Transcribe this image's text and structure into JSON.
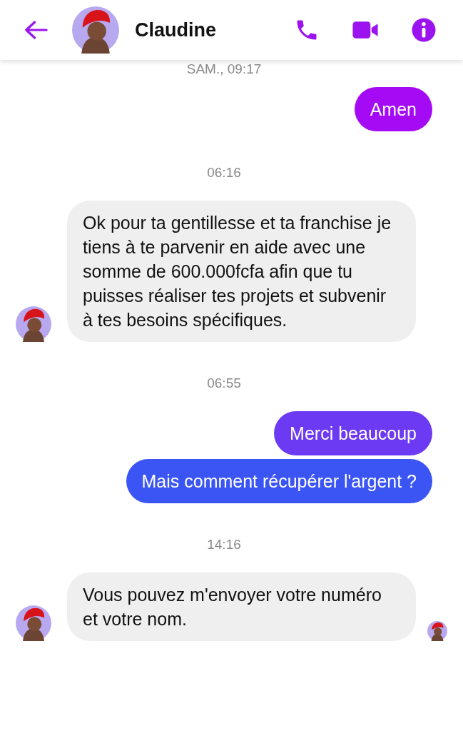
{
  "header": {
    "contact_name": "Claudine"
  },
  "messages": [
    {
      "kind": "timestamp",
      "text": "SAM., 09:17"
    },
    {
      "kind": "sent",
      "text": "Amen",
      "color": "#a50af5"
    },
    {
      "kind": "timestamp",
      "text": "06:16"
    },
    {
      "kind": "received",
      "text": "Ok pour ta gentillesse et ta franchise je tiens à te parvenir en aide avec une somme de 600.000fcfa afin que tu puisses réaliser tes projets et subvenir à tes besoins spécifiques."
    },
    {
      "kind": "timestamp",
      "text": "06:55"
    },
    {
      "kind": "sent",
      "text": "Merci beaucoup",
      "color": "#6d3af4"
    },
    {
      "kind": "sent",
      "text": "Mais comment récupérer l'argent ?",
      "color": "#3b55f4"
    },
    {
      "kind": "timestamp",
      "text": "14:16"
    },
    {
      "kind": "received",
      "text": "Vous pouvez m'envoyer votre numéro et votre nom.",
      "seen": true
    }
  ]
}
